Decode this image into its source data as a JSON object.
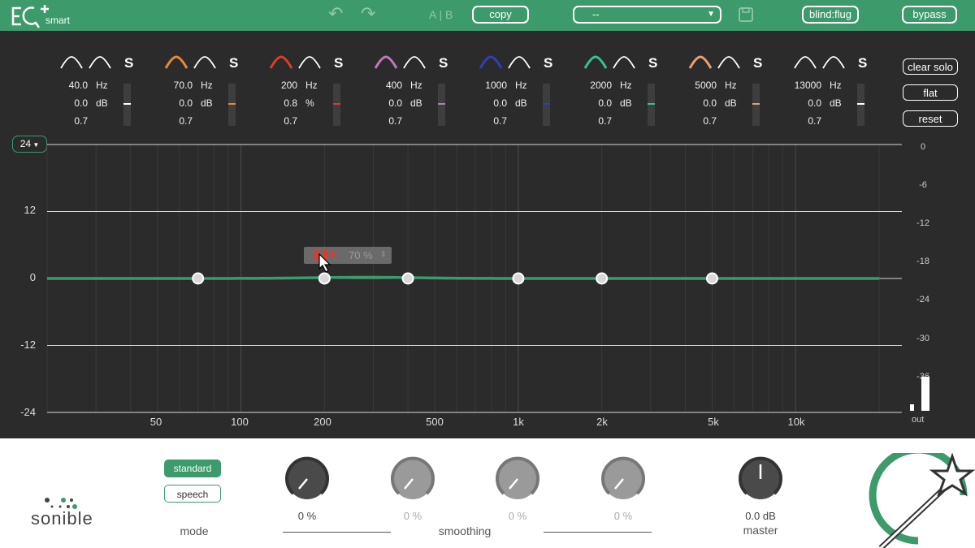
{
  "app": {
    "logo_sub": "smart"
  },
  "toolbar": {
    "ab": "A | B",
    "copy": "copy",
    "preset_value": "--",
    "blind": "blind:flug",
    "bypass": "bypass"
  },
  "bands": [
    {
      "freq": "40.0",
      "gain": "0.0",
      "q": "0.7",
      "gain_unit": "dB",
      "color": "#ffffff"
    },
    {
      "freq": "70.0",
      "gain": "0.0",
      "q": "0.7",
      "gain_unit": "dB",
      "color": "#e58a3c"
    },
    {
      "freq": "200",
      "gain": "0.8",
      "q": "0.7",
      "gain_unit": "%",
      "color": "#e03a2a"
    },
    {
      "freq": "400",
      "gain": "0.0",
      "q": "0.7",
      "gain_unit": "dB",
      "color": "#b97bbf"
    },
    {
      "freq": "1000",
      "gain": "0.0",
      "q": "0.7",
      "gain_unit": "dB",
      "color": "#2f3fb8"
    },
    {
      "freq": "2000",
      "gain": "0.0",
      "q": "0.7",
      "gain_unit": "dB",
      "color": "#3bbf94"
    },
    {
      "freq": "5000",
      "gain": "0.0",
      "q": "0.7",
      "gain_unit": "dB",
      "color": "#e8a070"
    },
    {
      "freq": "13000",
      "gain": "0.0",
      "q": "0.7",
      "gain_unit": "dB",
      "color": "#ffffff"
    }
  ],
  "units": {
    "hz": "Hz",
    "solo": "S"
  },
  "side": {
    "clear_solo": "clear solo",
    "flat": "flat",
    "reset": "reset"
  },
  "graph": {
    "range": "24",
    "y_labels": [
      "12",
      "0",
      "-12",
      "-24"
    ],
    "meter_labels": [
      "0",
      "-6",
      "-12",
      "-18",
      "-24",
      "-30",
      "-36"
    ],
    "x_labels": [
      "50",
      "100",
      "200",
      "500",
      "1k",
      "2k",
      "5k",
      "10k"
    ],
    "out_label": "out",
    "popup_value": "70 %"
  },
  "bottom": {
    "mode_standard": "standard",
    "mode_speech": "speech",
    "mode_label": "mode",
    "brand": "sonible",
    "smoothing_label": "smoothing",
    "knobs": [
      "0 %",
      "0 %",
      "0 %",
      "0 %"
    ],
    "master_value": "0.0 dB",
    "master_label": "master"
  },
  "colors": {
    "accent": "#3c9a6b",
    "curve": "#3c9a6b"
  }
}
